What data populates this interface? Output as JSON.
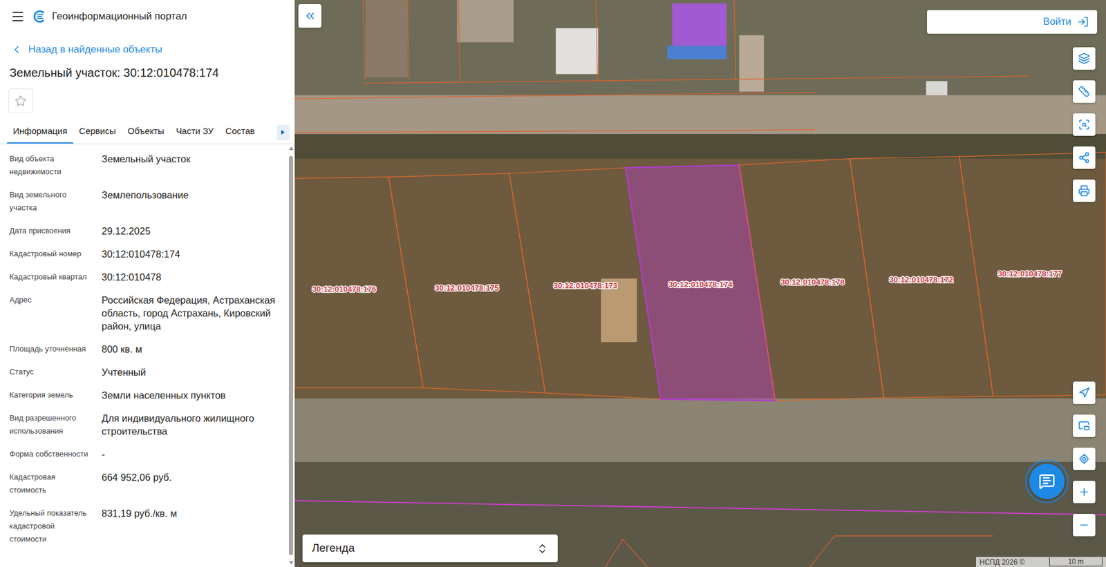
{
  "header": {
    "title": "Геоинформационный портал"
  },
  "back_link": "Назад в найденные объекты",
  "object_title": "Земельный участок: 30:12:010478:174",
  "favorite": false,
  "tabs": [
    {
      "label": "Информация",
      "selected": true
    },
    {
      "label": "Сервисы",
      "selected": false
    },
    {
      "label": "Объекты",
      "selected": false
    },
    {
      "label": "Части ЗУ",
      "selected": false
    },
    {
      "label": "Состав",
      "selected": false
    }
  ],
  "fields": [
    {
      "label": "Вид объекта недвижимости",
      "value": "Земельный участок"
    },
    {
      "label": "Вид земельного участка",
      "value": "Землепользование"
    },
    {
      "label": "Дата присвоения",
      "value": "29.12.2025"
    },
    {
      "label": "Кадастровый номер",
      "value": "30:12:010478:174"
    },
    {
      "label": "Кадастровый квартал",
      "value": "30:12:010478"
    },
    {
      "label": "Адрес",
      "value": "Российская Федерация, Астраханская область, город Астрахань, Кировский район, улица"
    },
    {
      "label": "Площадь уточненная",
      "value": "800 кв. м"
    },
    {
      "label": "Статус",
      "value": "Учтенный"
    },
    {
      "label": "Категория земель",
      "value": "Земли населенных пунктов"
    },
    {
      "label": "Вид разрешенного использования",
      "value": "Для индивидуального жилищного строительства"
    },
    {
      "label": "Форма собственности",
      "value": "-"
    },
    {
      "label": "Кадастровая стоимость",
      "value": "664 952,06 руб."
    },
    {
      "label": "Удельный показатель кадастровой стоимости",
      "value": "831,19 руб./кв. м"
    }
  ],
  "map": {
    "login_button": "Войти",
    "legend": "Легенда",
    "attribution": "НСПД 2026 ©",
    "scale": "10 m",
    "parcels": [
      {
        "label": "30:12:010478:176",
        "selected": false
      },
      {
        "label": "30:12:010478:175",
        "selected": false
      },
      {
        "label": "30:12:010478:173",
        "selected": false
      },
      {
        "label": "30:12:010478:174",
        "selected": true
      },
      {
        "label": "30:12:010478:178",
        "selected": false
      },
      {
        "label": "30:12:010478:172",
        "selected": false
      },
      {
        "label": "30:12:010478:177",
        "selected": false
      }
    ]
  }
}
